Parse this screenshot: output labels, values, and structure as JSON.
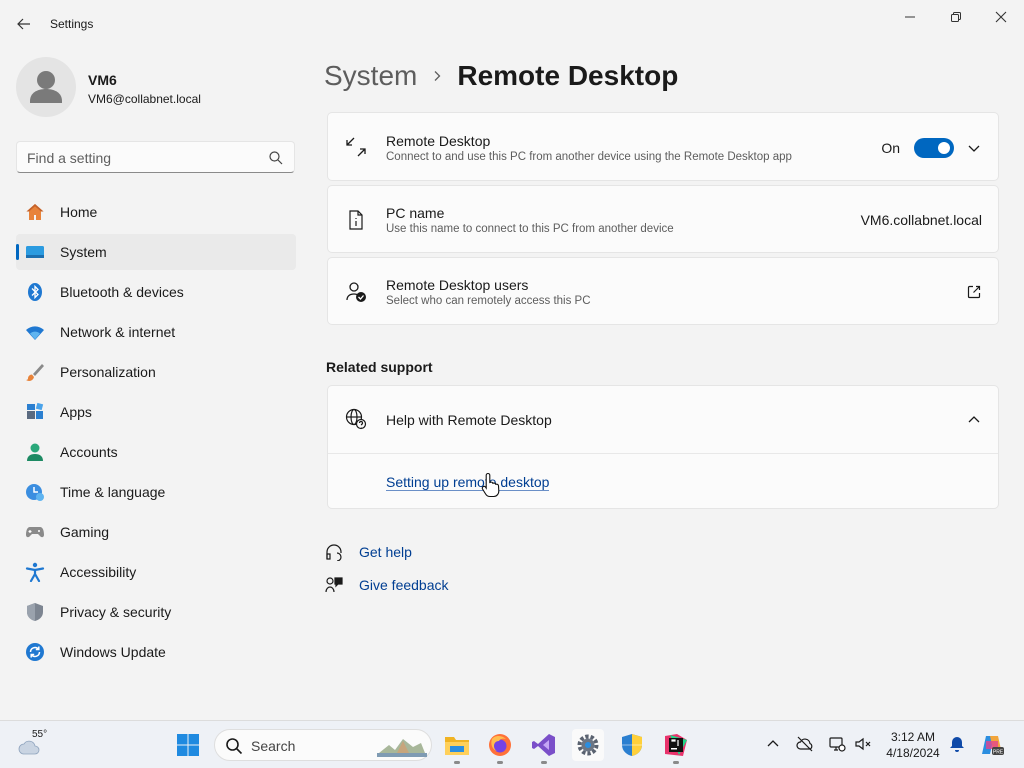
{
  "window": {
    "title": "Settings"
  },
  "profile": {
    "name": "VM6",
    "email": "VM6@collabnet.local"
  },
  "search": {
    "placeholder": "Find a setting"
  },
  "nav": {
    "items": [
      {
        "label": "Home",
        "icon": "home-icon"
      },
      {
        "label": "System",
        "icon": "system-icon",
        "selected": true
      },
      {
        "label": "Bluetooth & devices",
        "icon": "bluetooth-icon"
      },
      {
        "label": "Network & internet",
        "icon": "wifi-icon"
      },
      {
        "label": "Personalization",
        "icon": "brush-icon"
      },
      {
        "label": "Apps",
        "icon": "apps-icon"
      },
      {
        "label": "Accounts",
        "icon": "accounts-icon"
      },
      {
        "label": "Time & language",
        "icon": "time-language-icon"
      },
      {
        "label": "Gaming",
        "icon": "gaming-icon"
      },
      {
        "label": "Accessibility",
        "icon": "accessibility-icon"
      },
      {
        "label": "Privacy & security",
        "icon": "shield-icon"
      },
      {
        "label": "Windows Update",
        "icon": "update-icon"
      }
    ]
  },
  "breadcrumb": {
    "parent": "System",
    "current": "Remote Desktop"
  },
  "remote_desktop": {
    "title": "Remote Desktop",
    "description": "Connect to and use this PC from another device using the Remote Desktop app",
    "toggle_label": "On",
    "enabled": true
  },
  "pc_name": {
    "title": "PC name",
    "description": "Use this name to connect to this PC from another device",
    "value": "VM6.collabnet.local"
  },
  "remote_users": {
    "title": "Remote Desktop users",
    "description": "Select who can remotely access this PC"
  },
  "related_support": {
    "heading": "Related support",
    "help_title": "Help with Remote Desktop",
    "link": "Setting up remote desktop"
  },
  "footer": {
    "get_help": "Get help",
    "give_feedback": "Give feedback"
  },
  "taskbar": {
    "weather_temp": "55°",
    "search_label": "Search",
    "time": "3:12 AM",
    "date": "4/18/2024"
  },
  "colors": {
    "accent": "#0067c0",
    "link": "#003e92",
    "background": "#f3f3f3",
    "card": "#fbfbfb"
  }
}
